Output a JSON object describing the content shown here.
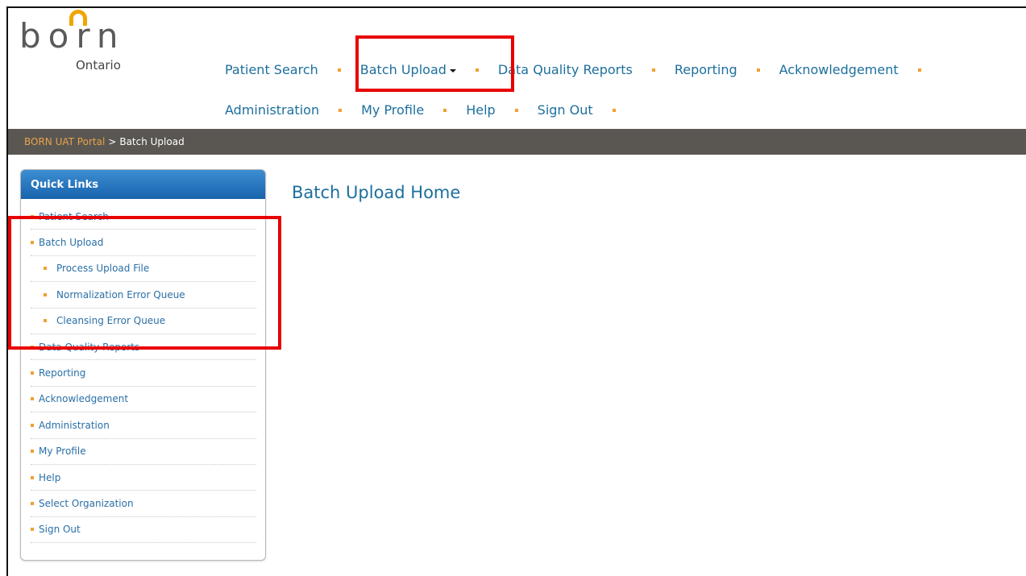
{
  "logo": {
    "word": "born",
    "sub": "Ontario"
  },
  "nav": {
    "row1": [
      {
        "label": "Patient Search"
      },
      {
        "label": "Batch Upload",
        "dropdown": true
      },
      {
        "label": "Data Quality Reports"
      },
      {
        "label": "Reporting"
      },
      {
        "label": "Acknowledgement"
      }
    ],
    "row2": [
      {
        "label": "Administration"
      },
      {
        "label": "My Profile"
      },
      {
        "label": "Help"
      },
      {
        "label": "Sign Out"
      }
    ]
  },
  "breadcrumb": {
    "root": "BORN UAT Portal",
    "separator": ">",
    "current": "Batch Upload"
  },
  "quick_links": {
    "title": "Quick Links",
    "items": [
      {
        "label": "Patient Search",
        "level": 0
      },
      {
        "label": "Batch Upload",
        "level": 0
      },
      {
        "label": "Process Upload File",
        "level": 1
      },
      {
        "label": "Normalization Error Queue",
        "level": 1
      },
      {
        "label": "Cleansing Error Queue",
        "level": 1
      },
      {
        "label": "Data Quality Reports",
        "level": 0
      },
      {
        "label": "Reporting",
        "level": 0
      },
      {
        "label": "Acknowledgement",
        "level": 0
      },
      {
        "label": "Administration",
        "level": 0
      },
      {
        "label": "My Profile",
        "level": 0
      },
      {
        "label": "Help",
        "level": 0
      },
      {
        "label": "Select Organization",
        "level": 0
      },
      {
        "label": "Sign Out",
        "level": 0
      }
    ]
  },
  "main": {
    "title": "Batch Upload Home"
  },
  "colors": {
    "link": "#1d6f9c",
    "accent_orange": "#f0a030",
    "breadcrumb_bar": "#5a5752",
    "panel_header": "#1763ad",
    "highlight_red": "#e80000"
  }
}
